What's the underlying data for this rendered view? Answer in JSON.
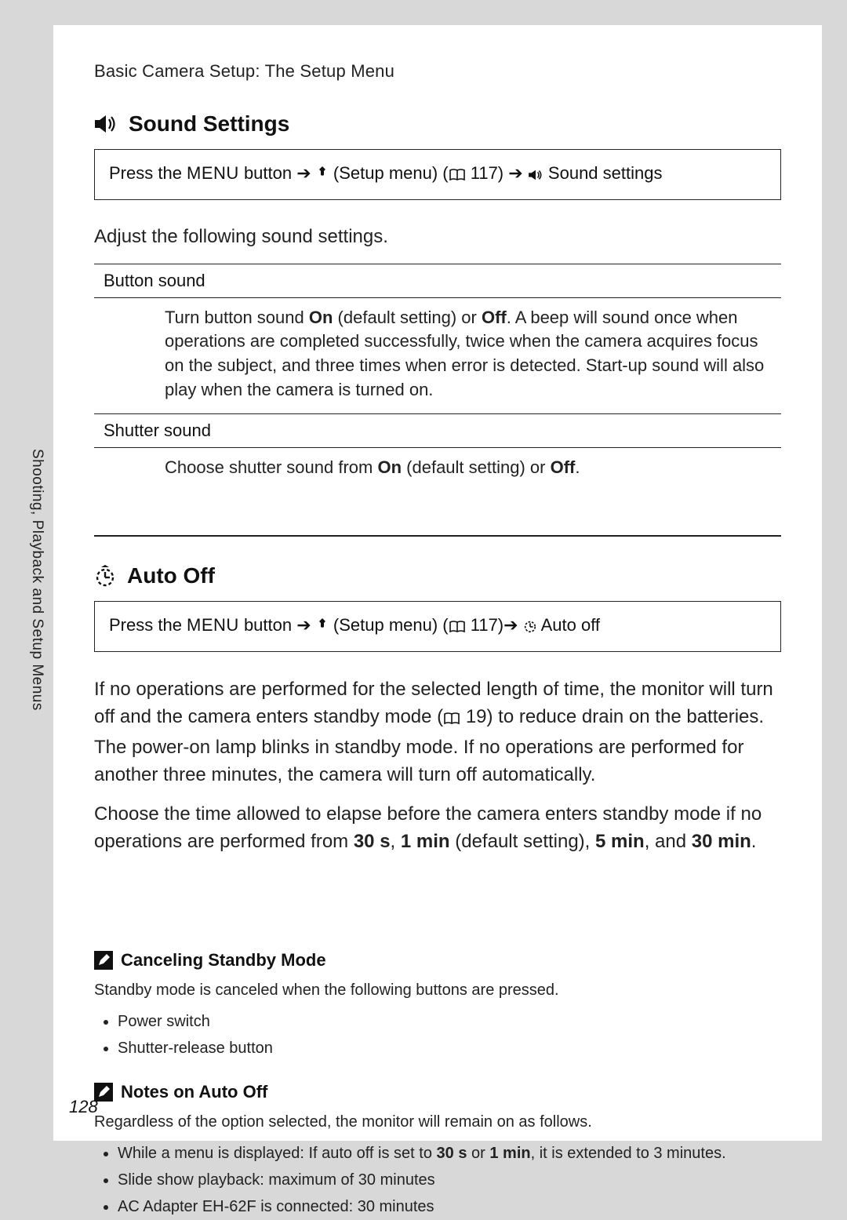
{
  "breadcrumb": "Basic Camera Setup: The Setup Menu",
  "side_label": "Shooting, Playback and Setup Menus",
  "page_number": "128",
  "sound": {
    "title": "Sound Settings",
    "path_pre": "Press the ",
    "menu_word": "MENU",
    "path_btn": " button ",
    "arrow": "➔",
    "setup_menu": " (Setup menu) (",
    "page_ref": " 117) ",
    "tail": " Sound settings",
    "lead": "Adjust the following sound settings.",
    "rows": [
      {
        "head": "Button sound",
        "body_pre": "Turn button sound ",
        "on": "On",
        "body_mid1": " (default setting) or ",
        "off": "Off",
        "body_post": ". A beep will sound once when operations are completed successfully, twice when the camera acquires focus on the subject, and three times when error is detected. Start-up sound will also play when the camera is turned on."
      },
      {
        "head": "Shutter sound",
        "body_pre": "Choose shutter sound from ",
        "on": "On",
        "body_mid1": " (default setting) or ",
        "off": "Off",
        "body_post": "."
      }
    ]
  },
  "autooff": {
    "title": "Auto Off",
    "path_pre": "Press the ",
    "menu_word": "MENU",
    "path_btn": " button ",
    "arrow": "➔",
    "setup_menu": " (Setup menu) (",
    "page_ref": " 117)",
    "tail": " Auto off",
    "p1_pre": "If no operations are performed for the selected length of time, the monitor will turn off and the camera enters standby mode (",
    "p1_ref": " 19) to reduce drain on the batteries. The power-on lamp blinks in standby mode. If no operations are performed for another three minutes, the camera will turn off automatically.",
    "p2_pre": "Choose the time allowed to elapse before the camera enters standby mode if no operations are performed from ",
    "opt1": "30 s",
    "sep": ", ",
    "opt2": "1 min",
    "p2_mid": " (default setting), ",
    "opt3": "5 min",
    "and": ", and ",
    "opt4": "30 min",
    "dot": "."
  },
  "cancel": {
    "title": "Canceling Standby Mode",
    "lead": "Standby mode is canceled when the following buttons are pressed.",
    "items": [
      "Power switch",
      "Shutter-release button"
    ]
  },
  "notes": {
    "title": "Notes on Auto Off",
    "lead": "Regardless of the option selected, the monitor will remain on as follows.",
    "items_pre": "While a menu is displayed: If auto off is set to ",
    "b1": "30 s",
    "or": " or ",
    "b2": "1 min",
    "items_post": ", it is extended to 3 minutes.",
    "item2": "Slide show playback: maximum of 30 minutes",
    "item3": "AC Adapter EH-62F is connected: 30 minutes"
  }
}
